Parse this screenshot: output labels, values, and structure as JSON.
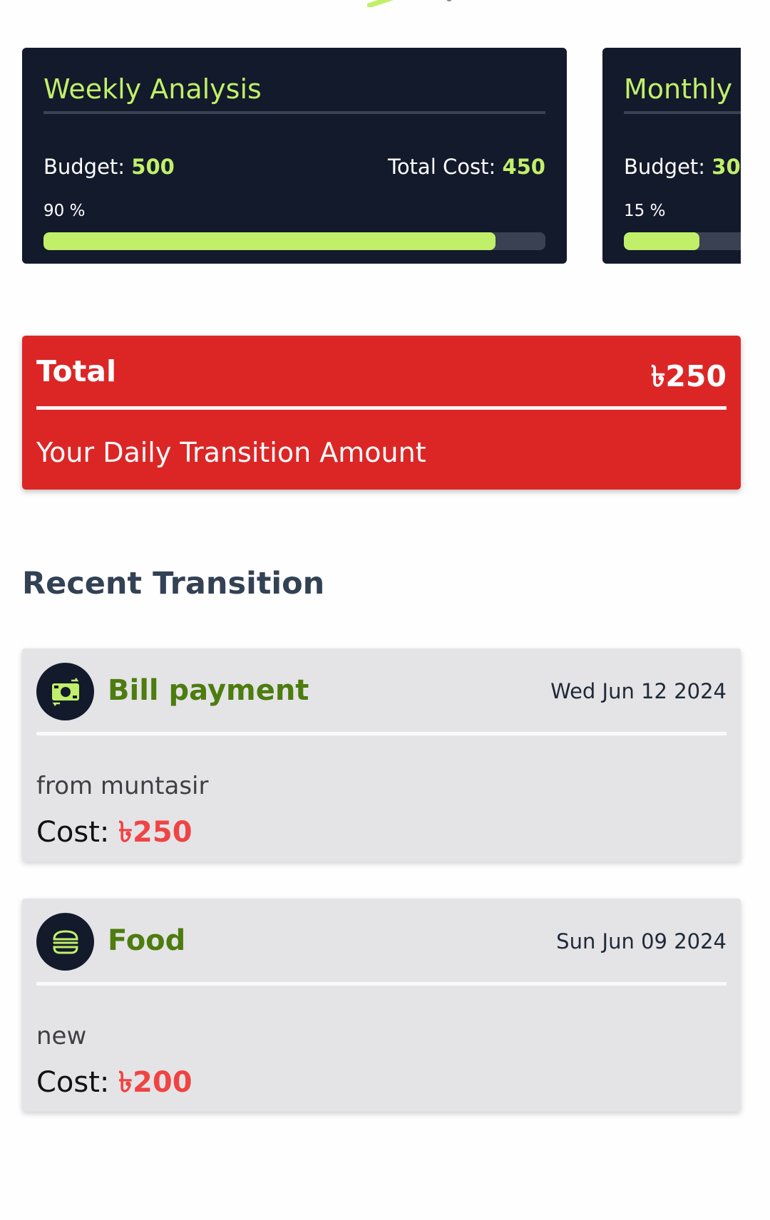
{
  "weekly": {
    "title": "Weekly Analysis",
    "budget_label": "Budget:",
    "budget_value": "500",
    "cost_label": "Total Cost:",
    "cost_value": "450",
    "percent_text": "90 %",
    "progress": 0.9
  },
  "monthly": {
    "title": "Monthly",
    "budget_label": "Budget:",
    "budget_value": "30",
    "percent_text": "15 %",
    "progress": 0.15
  },
  "total": {
    "label": "Total",
    "amount": "৳250",
    "subtitle": "Your Daily Transition Amount"
  },
  "recent": {
    "heading": "Recent Transition",
    "cost_label": "Cost:",
    "items": [
      {
        "title": "Bill payment",
        "date": "Wed Jun 12 2024",
        "note": "from muntasir",
        "cost": "৳250",
        "icon": "money-icon"
      },
      {
        "title": "Food",
        "date": "Sun Jun 09 2024",
        "note": "new",
        "cost": "৳200",
        "icon": "burger-icon"
      }
    ]
  },
  "colors": {
    "card_dark": "#131a2b",
    "accent_green": "#c1ef6a",
    "total_red": "#dc2626",
    "cost_red": "#ef4444",
    "title_green": "#4d7c0f"
  }
}
